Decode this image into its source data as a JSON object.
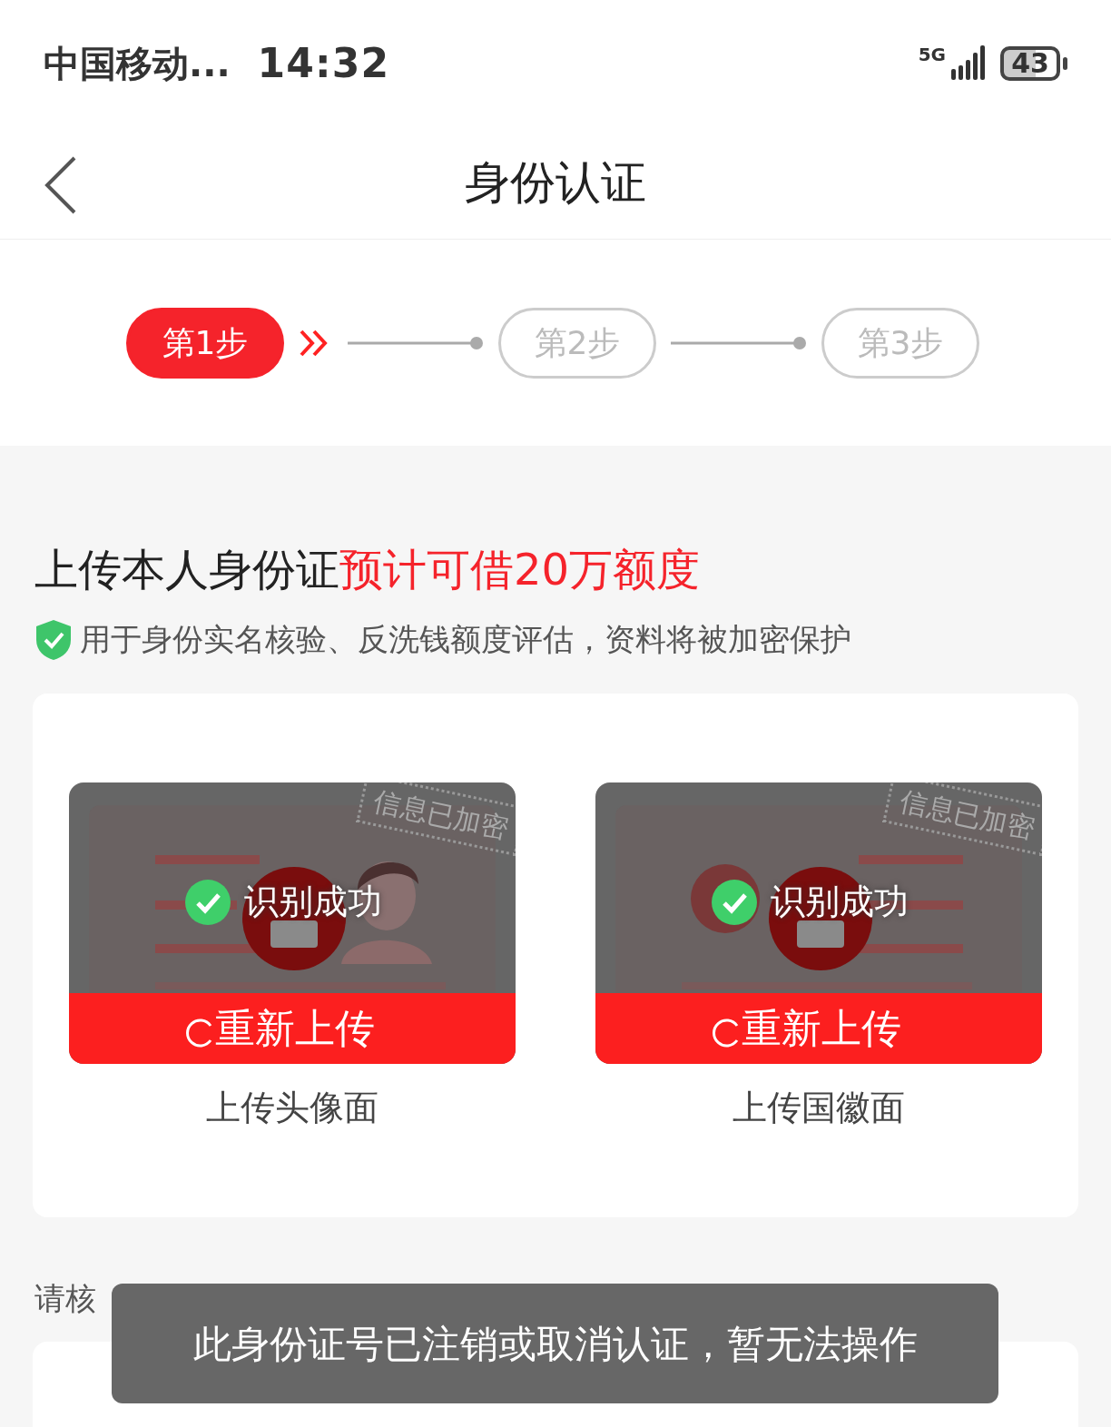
{
  "status_bar": {
    "carrier": "中国移动...",
    "time": "14:32",
    "network": "5G",
    "battery": "43"
  },
  "nav": {
    "title": "身份认证"
  },
  "steps": [
    {
      "label": "第1步",
      "selected": true
    },
    {
      "label": "第2步",
      "selected": false
    },
    {
      "label": "第3步",
      "selected": false
    }
  ],
  "heading": {
    "main": "上传本人身份证",
    "highlight": "预计可借20万额度"
  },
  "notice": "用于身份实名核验、反洗钱额度评估，资料将被加密保护",
  "uploads": [
    {
      "kind": "portrait",
      "stamp": "信息已加密",
      "status": "识别成功",
      "recognized": true,
      "button": "重新上传",
      "caption": "上传头像面"
    },
    {
      "kind": "emblem",
      "stamp": "信息已加密",
      "status": "识别成功",
      "recognized": true,
      "button": "重新上传",
      "caption": "上传国徽面"
    }
  ],
  "verify_hint": "请核",
  "toast": "此身份证号已注销或取消认证，暂无法操作"
}
